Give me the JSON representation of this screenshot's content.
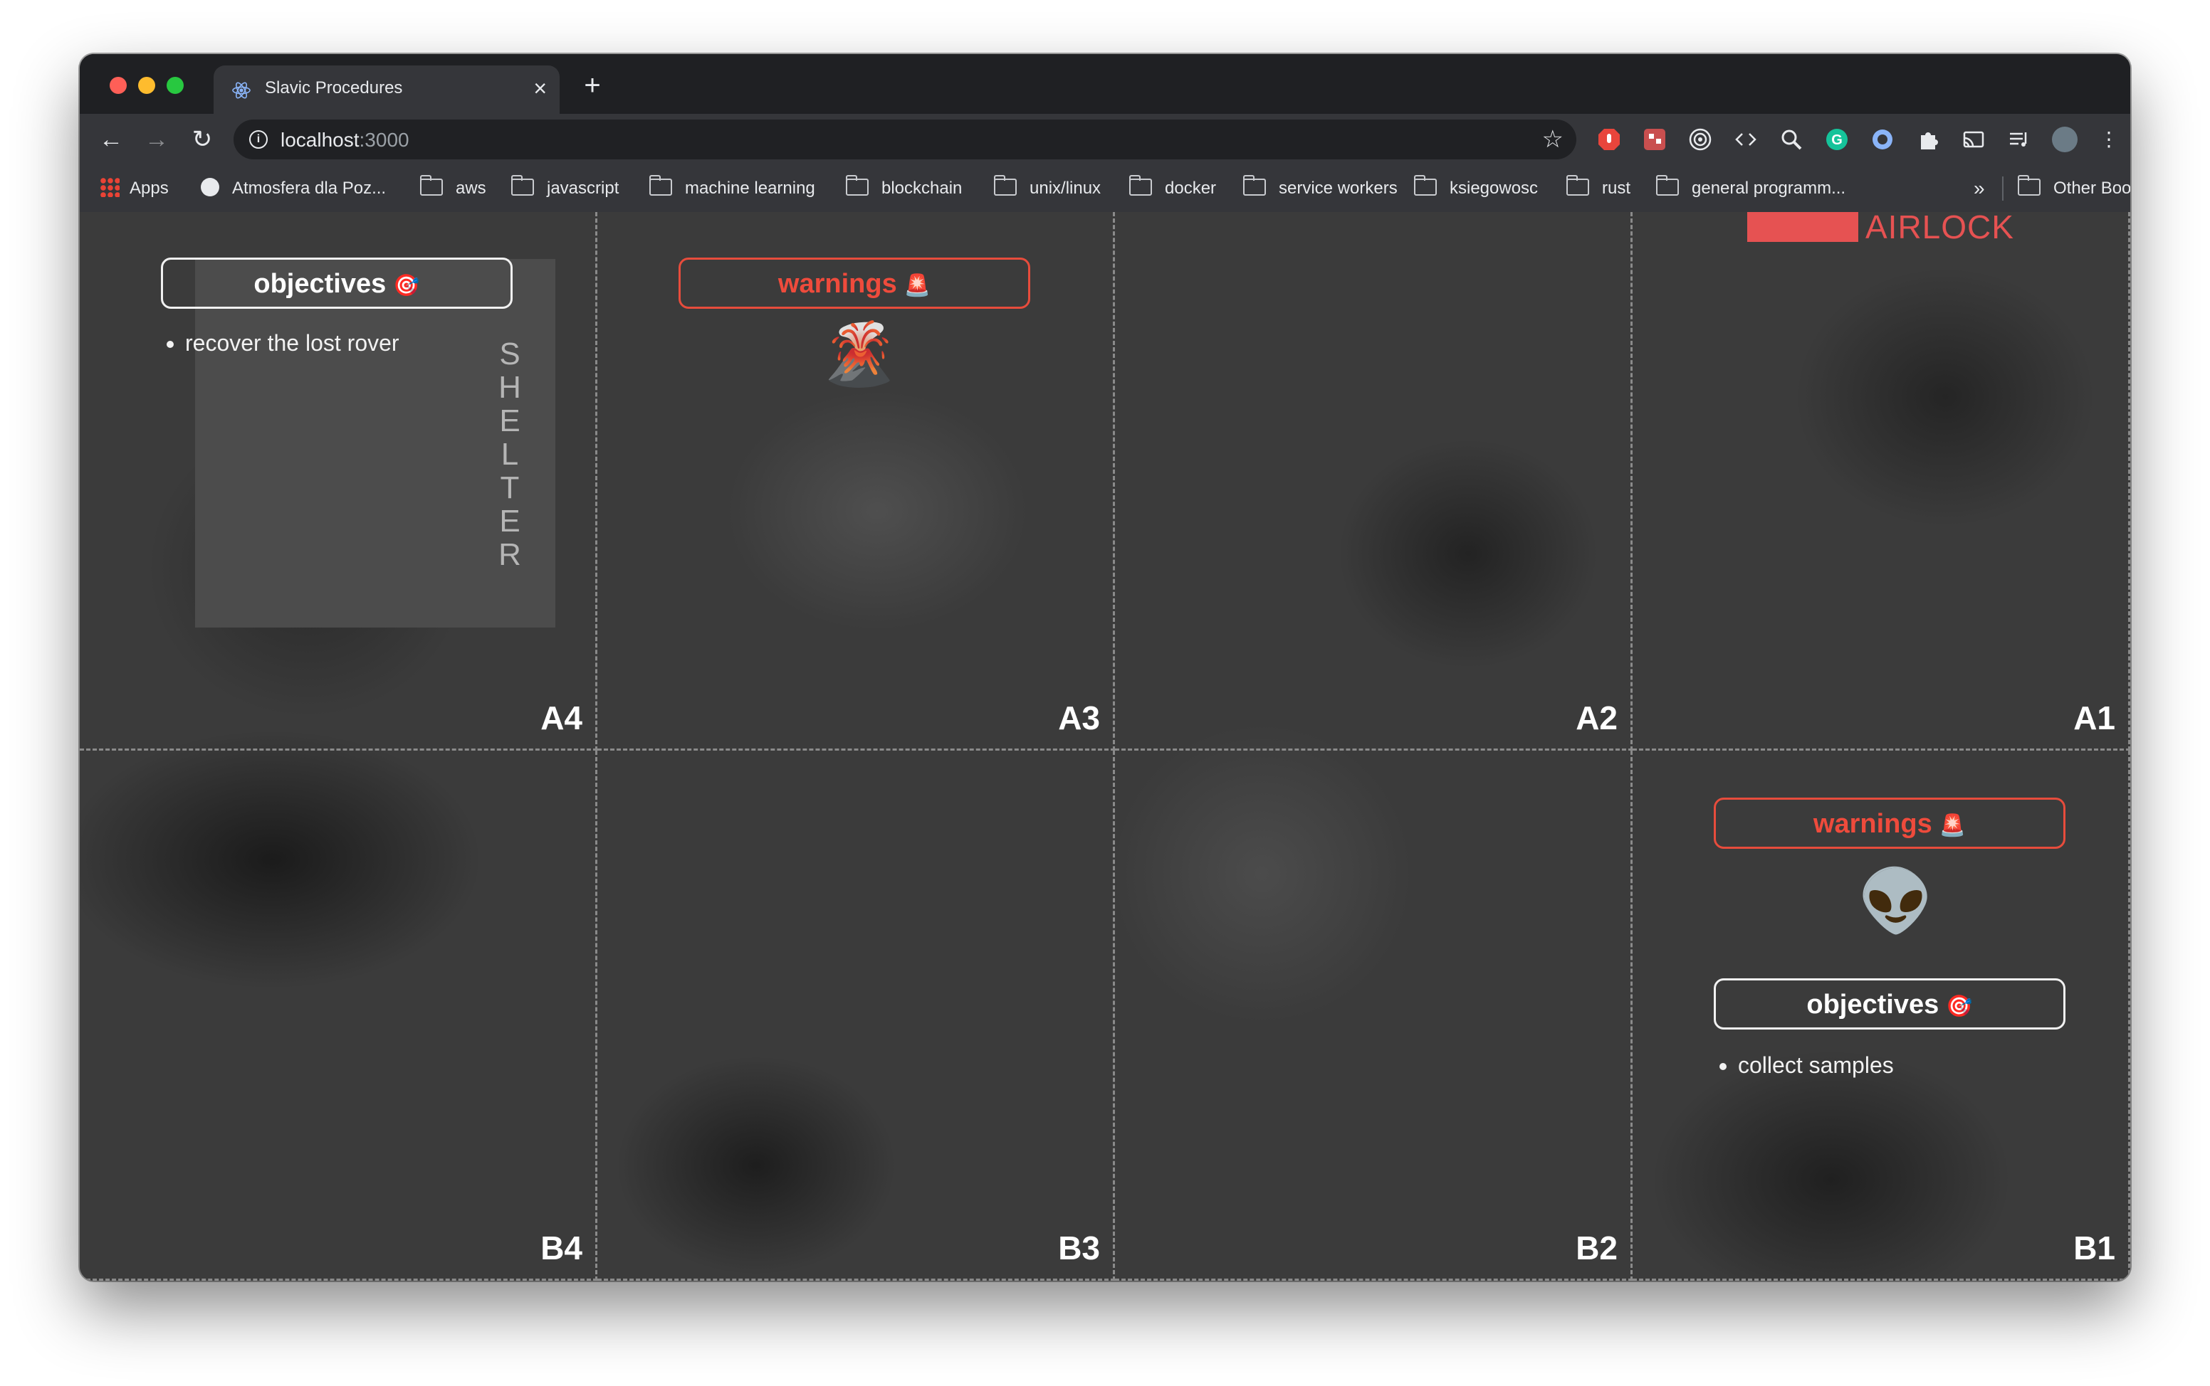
{
  "browser": {
    "tab_title": "Slavic Procedures",
    "tab_close": "×",
    "new_tab": "+",
    "url_host": "localhost",
    "url_port": ":3000",
    "info_symbol": "i",
    "star_symbol": "☆",
    "back_symbol": "←",
    "forward_symbol": "→",
    "reload_symbol": "↻",
    "overflow_symbol": "»",
    "menu_symbol": "⋮"
  },
  "bookmarks": {
    "items": [
      "Apps",
      "Atmosfera dla Poz...",
      "aws",
      "javascript",
      "machine learning",
      "blockchain",
      "unix/linux",
      "docker",
      "service workers",
      "ksiegowosc",
      "rust",
      "general programm..."
    ],
    "other": "Other Bookmarks"
  },
  "grid": {
    "cells": [
      "A4",
      "A3",
      "A2",
      "A1",
      "B4",
      "B3",
      "B2",
      "B1"
    ],
    "shelter_label": "SHELTER",
    "airlock_label": "AIRLOCK",
    "a4": {
      "objectives_label": "objectives",
      "objectives_icon": "🎯",
      "objectives": [
        "recover the lost rover"
      ]
    },
    "a3": {
      "warnings_label": "warnings",
      "warnings_icon": "🚨",
      "emoji": "🌋"
    },
    "b1": {
      "warnings_label": "warnings",
      "warnings_icon": "🚨",
      "emoji": "👽",
      "objectives_label": "objectives",
      "objectives_icon": "🎯",
      "objectives": [
        "collect samples"
      ]
    }
  },
  "colors": {
    "accent_red": "#e65252",
    "warning_red": "#ef4b3c",
    "background": "#3b3b3b"
  }
}
